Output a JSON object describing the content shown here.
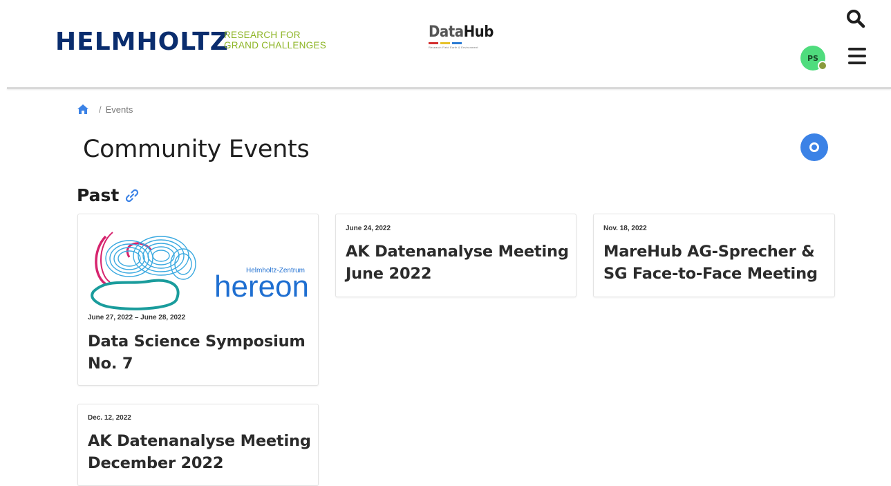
{
  "header": {
    "logo_name": "HELMHOLTZ",
    "logo_tagline_line1": "RESEARCH FOR",
    "logo_tagline_line2": "GRAND CHALLENGES",
    "datahub_part1": "Data",
    "datahub_part2": "Hub",
    "datahub_subtitle": "Research Field Earth & Environment",
    "avatar_initials": "PS",
    "icons": [
      "search-icon",
      "menu-icon"
    ]
  },
  "breadcrumb": {
    "separator": "/",
    "current": "Events"
  },
  "page": {
    "title": "Community Events",
    "section_past": "Past"
  },
  "events": [
    {
      "image_text_small": "Helmholtz-Zentrum",
      "image_text_large": "hereon",
      "date": "June 27, 2022 – June 28, 2022",
      "title": "Data Science Symposium No. 7"
    },
    {
      "date": "June 24, 2022",
      "title": "AK Datenanalyse Meeting June 2022"
    },
    {
      "date": "Nov. 18, 2022",
      "title": "MareHub AG-Sprecher & SG Face-to-Face Meeting"
    },
    {
      "date": "Dec. 12, 2022",
      "title": "AK Datenanalyse Meeting December 2022"
    }
  ],
  "colors": {
    "helmholtz_blue": "#0a2d6e",
    "tagline_green": "#8cb423",
    "accent_blue": "#3b82e6",
    "avatar_green": "#4fdc7d",
    "hereon_blue": "#1f6fd1",
    "hereon_teal": "#1a9c9c",
    "hereon_pink": "#d6246e"
  }
}
